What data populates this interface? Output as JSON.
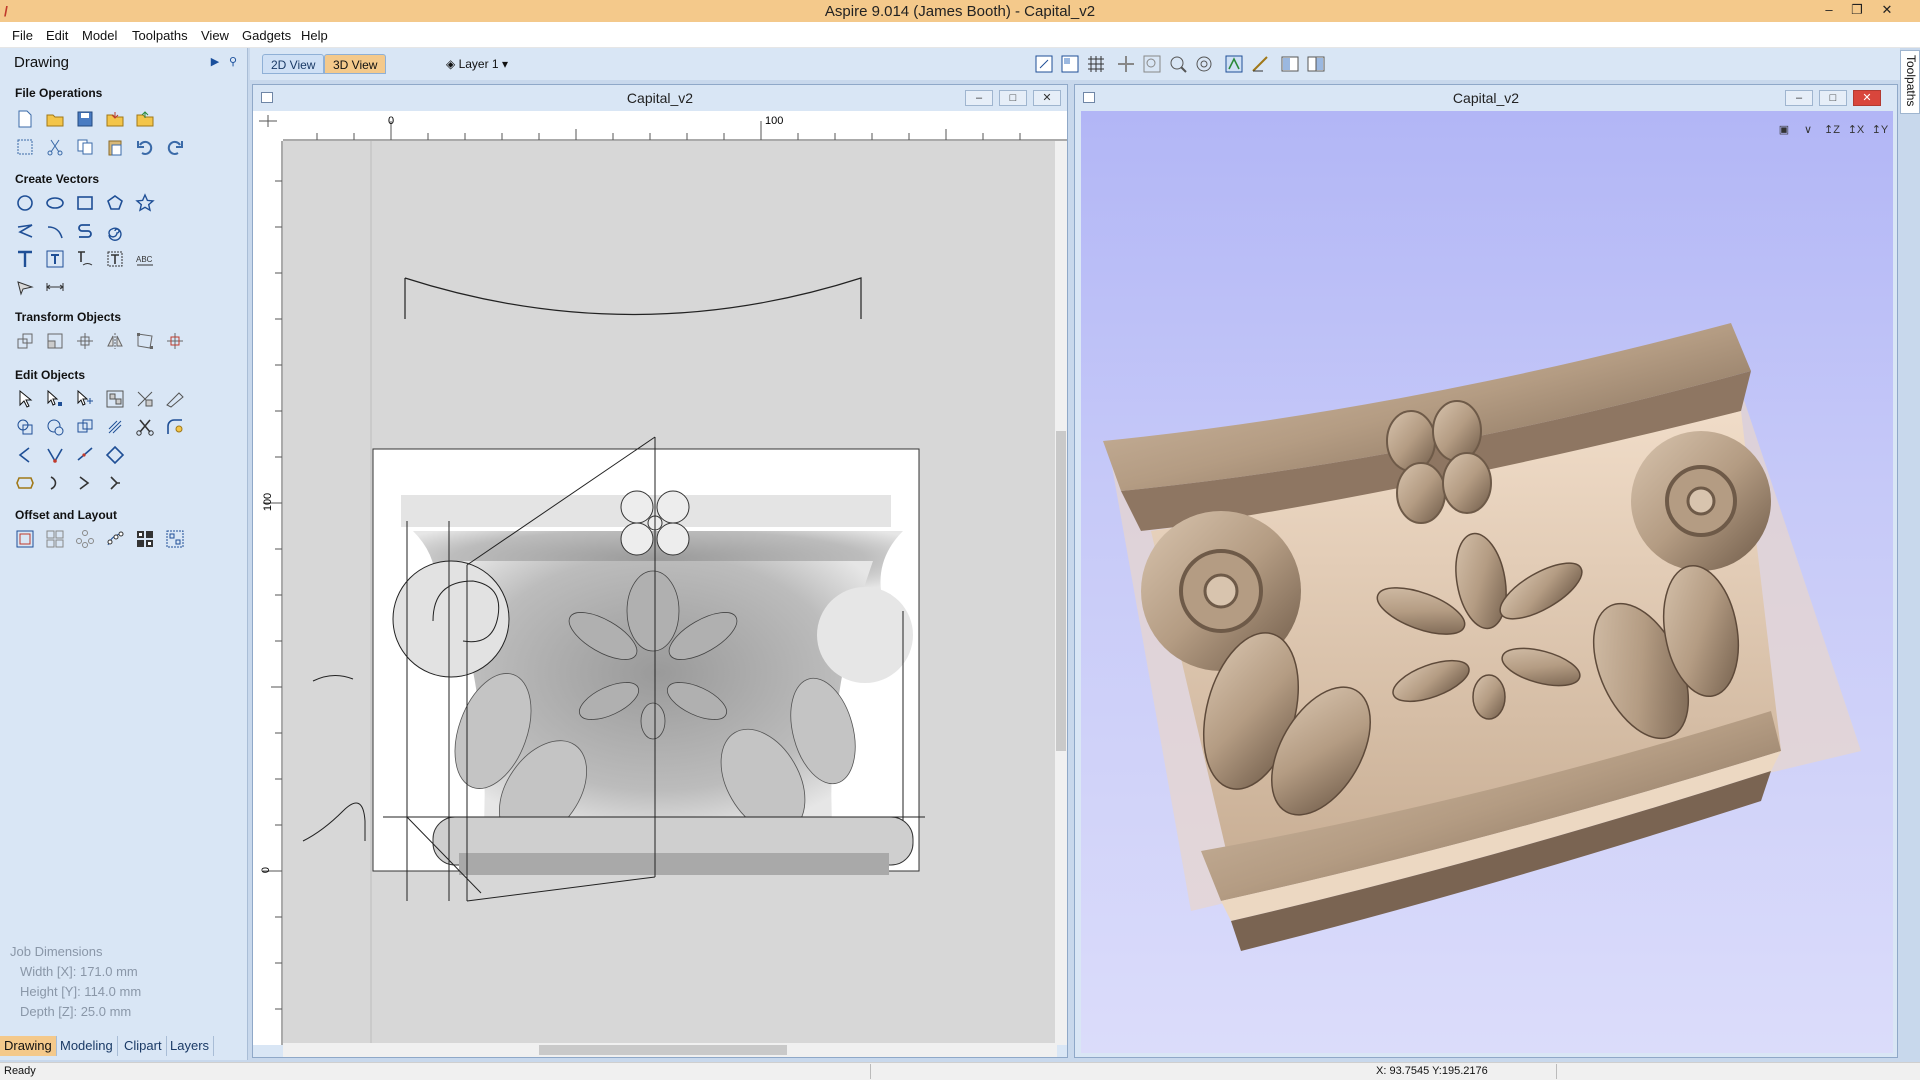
{
  "window": {
    "title": "Aspire 9.014 (James Booth) - Capital_v2"
  },
  "menu": [
    "File",
    "Edit",
    "Model",
    "Toolpaths",
    "View",
    "Gadgets",
    "Help"
  ],
  "left_panel": {
    "title": "Drawing",
    "sections": {
      "file_operations": "File Operations",
      "create_vectors": "Create Vectors",
      "transform_objects": "Transform Objects",
      "edit_objects": "Edit Objects",
      "offset_layout": "Offset and Layout"
    },
    "job_dimensions": {
      "title": "Job Dimensions",
      "width": "Width  [X]: 171.0 mm",
      "height": "Height [Y]: 114.0 mm",
      "depth": "Depth  [Z]: 25.0 mm"
    },
    "bottom_tabs": [
      "Drawing",
      "Modeling",
      "Clipart",
      "Layers"
    ]
  },
  "view_tabs": {
    "tab_2d": "2D View",
    "tab_3d": "3D View",
    "layer": "Layer 1"
  },
  "toolpaths_tab": "Toolpaths",
  "doc_2d": {
    "title": "Capital_v2",
    "ruler_top": [
      "0",
      "100"
    ],
    "ruler_left": [
      "100",
      "0"
    ]
  },
  "doc_3d": {
    "title": "Capital_v2"
  },
  "status": {
    "left": "Ready",
    "coords": "X: 93.7545 Y:195.2176"
  },
  "colors": {
    "accent_orange": "#f4c98b",
    "panel_bg": "#d9e6f5",
    "view3d_bg": "#b2b6f6",
    "model_wood": "#b49c83"
  }
}
